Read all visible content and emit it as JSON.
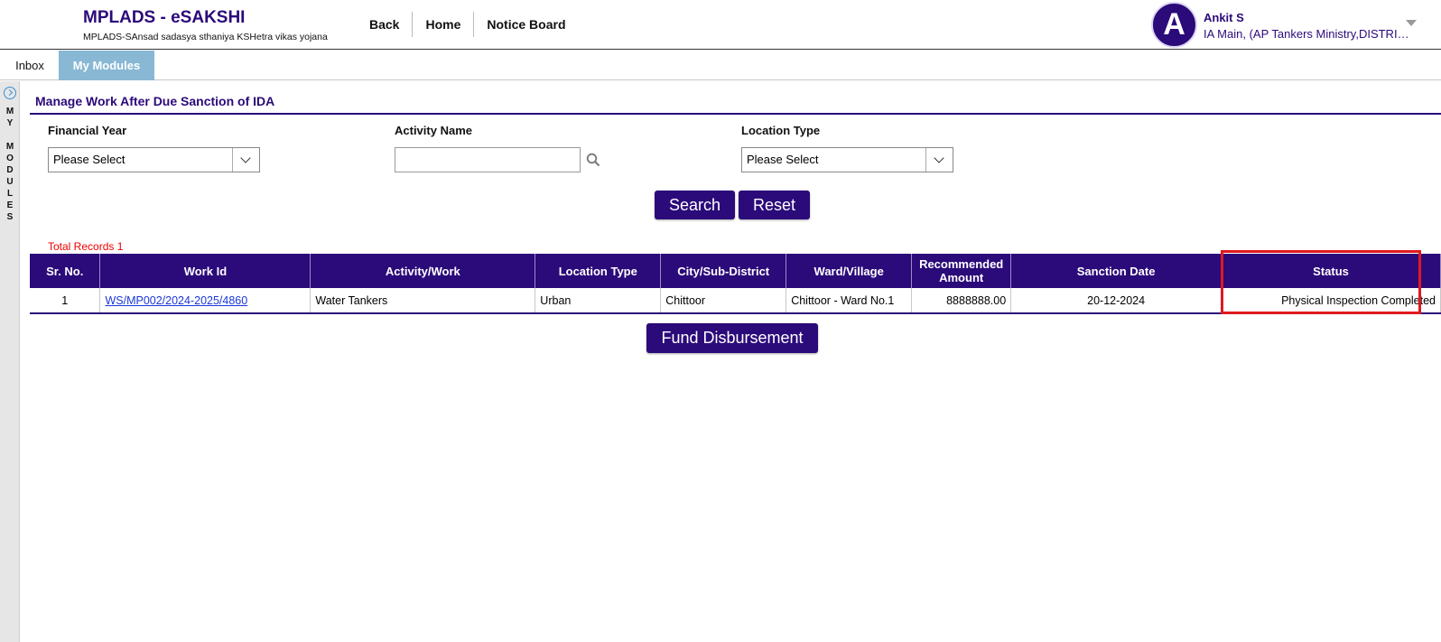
{
  "header": {
    "title": "MPLADS - eSAKSHI",
    "subtitle": "MPLADS-SAnsad sadasya sthaniya KSHetra vikas yojana",
    "nav": [
      "Back",
      "Home",
      "Notice Board"
    ],
    "user": {
      "initial": "A",
      "name": "Ankit S",
      "role": "IA Main, (AP Tankers Ministry,DISTRICT CHITTOOR)"
    }
  },
  "tabs": {
    "inbox": "Inbox",
    "modules": "My Modules"
  },
  "sidebar": {
    "letters": [
      "M",
      "Y",
      "",
      "M",
      "O",
      "D",
      "U",
      "L",
      "E",
      "S"
    ]
  },
  "section": {
    "title": "Manage Work After Due Sanction of IDA"
  },
  "filters": {
    "financial_year": {
      "label": "Financial Year",
      "value": "Please Select"
    },
    "activity_name": {
      "label": "Activity Name",
      "value": ""
    },
    "location_type": {
      "label": "Location Type",
      "value": "Please Select"
    }
  },
  "buttons": {
    "search": "Search",
    "reset": "Reset",
    "fund": "Fund Disbursement"
  },
  "total_records": "Total Records 1",
  "table": {
    "headers": [
      "Sr. No.",
      "Work Id",
      "Activity/Work",
      "Location Type",
      "City/Sub-District",
      "Ward/Village",
      "Recommended Amount",
      "Sanction Date",
      "Status"
    ],
    "rows": [
      {
        "sr": "1",
        "work_id": "WS/MP002/2024-2025/4860",
        "activity": "Water Tankers",
        "location_type": "Urban",
        "city": "Chittoor",
        "ward": "Chittoor - Ward No.1",
        "amount": "8888888.00",
        "sanction_date": "20-12-2024",
        "status": "Physical Inspection Completed"
      }
    ]
  },
  "colors": {
    "brand": "#2b0a7a",
    "tab_active": "#88b8d4",
    "highlight": "#e0191f",
    "total_text": "#e00000"
  }
}
